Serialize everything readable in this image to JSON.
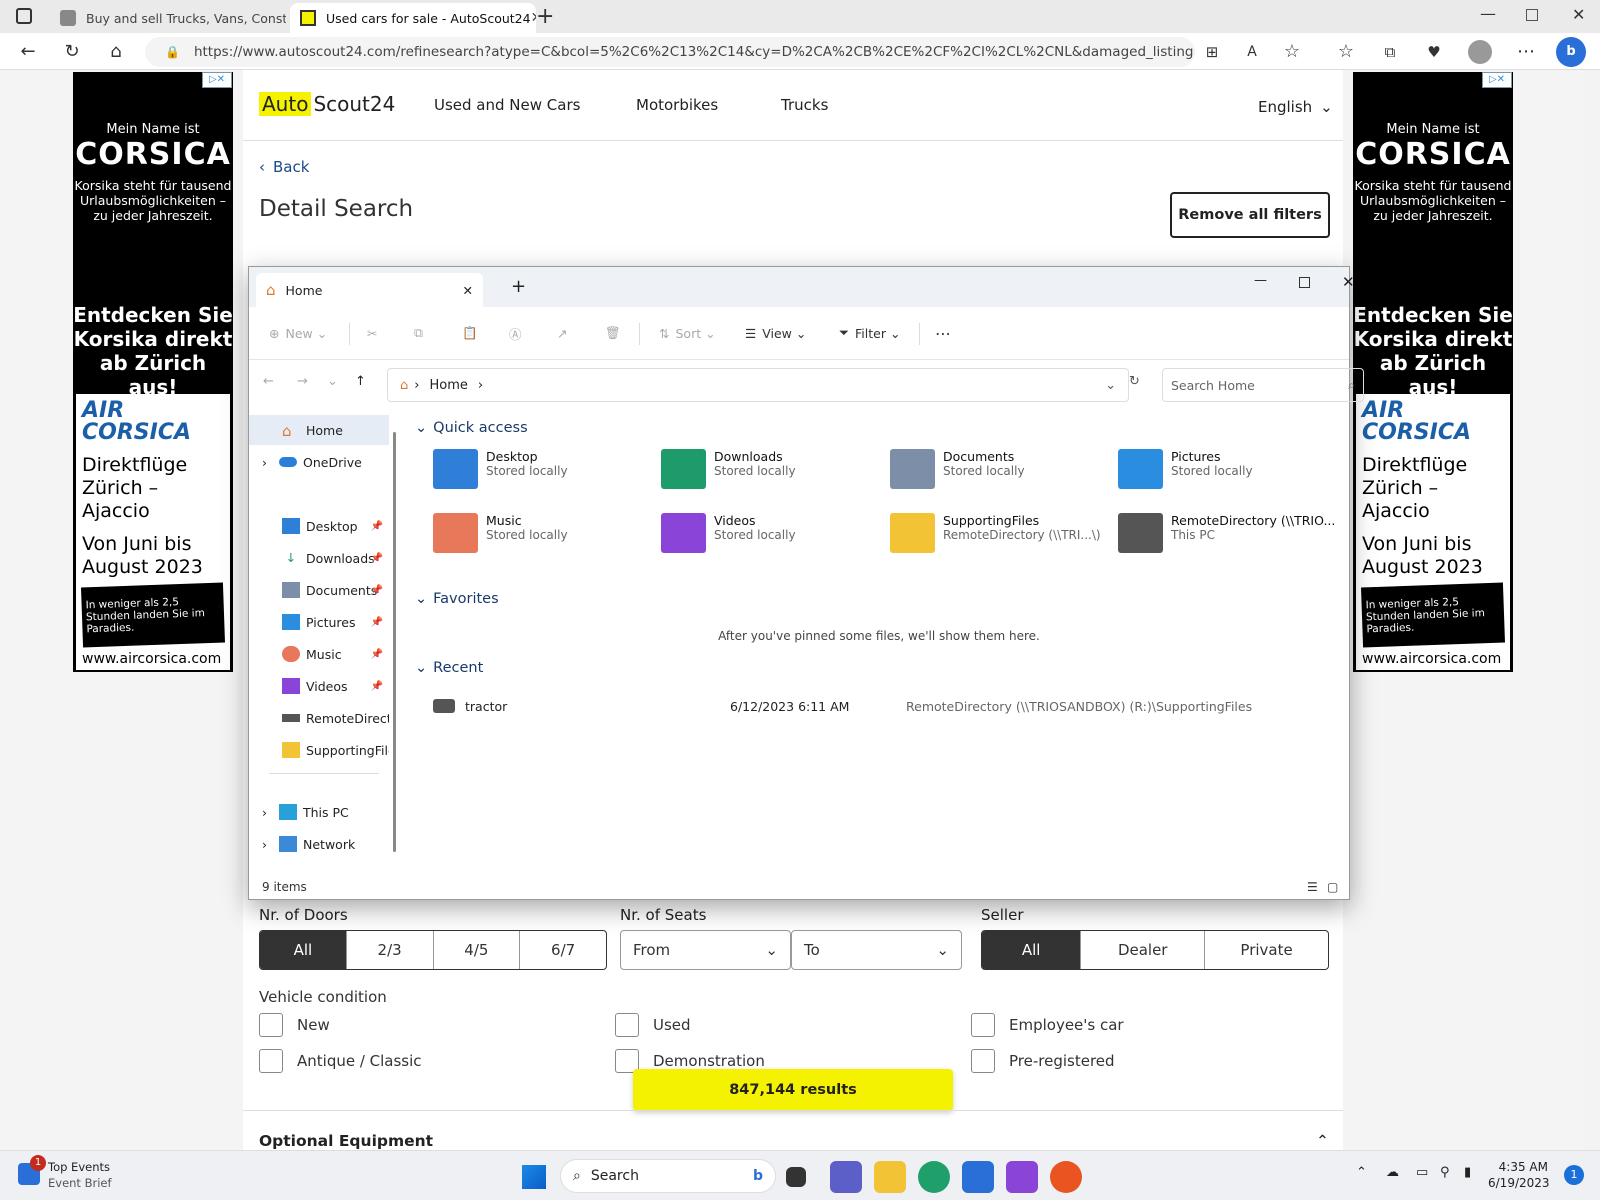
{
  "browser": {
    "tabs": [
      {
        "title": "Buy and sell Trucks, Vans, Constr..."
      },
      {
        "title": "Used cars for sale - AutoScout24"
      }
    ],
    "url": "https://www.autoscout24.com/refinesearch?atype=C&bcol=5%2C6%2C13%2C14&cy=D%2CA%2CB%2CE%2CF%2CI%2CL%2CNL&damaged_listing=exclude&d..."
  },
  "site": {
    "logo_auto": "Auto",
    "logo_scout": "Scout24",
    "nav": [
      "Used and New Cars",
      "Motorbikes",
      "Trucks"
    ],
    "language": "English",
    "back": "Back",
    "title": "Detail Search",
    "remove_filters": "Remove all filters",
    "doors_label": "Nr. of Doors",
    "doors": [
      "All",
      "2/3",
      "4/5",
      "6/7"
    ],
    "seats_label": "Nr. of Seats",
    "seats_from": "From",
    "seats_to": "To",
    "seller_label": "Seller",
    "seller": [
      "All",
      "Dealer",
      "Private"
    ],
    "condition_label": "Vehicle condition",
    "conditions": [
      "New",
      "Used",
      "Employee's car",
      "Antique / Classic",
      "Demonstration",
      "Pre-registered"
    ],
    "results": "847,144 results",
    "optional_equipment": "Optional Equipment"
  },
  "ad": {
    "line1": "Mein Name ist",
    "line2": "CORSICA",
    "line3": "Korsika steht für tausend Urlaubsmöglichkeiten – zu jeder Jahreszeit.",
    "line4": "Entdecken Sie Korsika direkt ab Zürich aus!",
    "brand": "AIR CORSICA",
    "flights": "Direktflüge Zürich – Ajaccio",
    "period": "Von Juni bis August 2023",
    "band": "In weniger als 2,5 Stunden landen Sie im Paradies.",
    "site": "www.aircorsica.com"
  },
  "explorer": {
    "tab_title": "Home",
    "toolbar": {
      "new": "New",
      "sort": "Sort",
      "view": "View",
      "filter": "Filter"
    },
    "path": "Home",
    "search_placeholder": "Search Home",
    "nav": {
      "home": "Home",
      "onedrive": "OneDrive",
      "pinned": [
        "Desktop",
        "Downloads",
        "Documents",
        "Pictures",
        "Music",
        "Videos",
        "RemoteDirector",
        "SupportingFiles"
      ],
      "thispc": "This PC",
      "network": "Network"
    },
    "quick_access_title": "Quick access",
    "quick_access": [
      {
        "name": "Desktop",
        "sub": "Stored locally",
        "color": "#2f7fd8"
      },
      {
        "name": "Downloads",
        "sub": "Stored locally",
        "color": "#1e9b6a"
      },
      {
        "name": "Documents",
        "sub": "Stored locally",
        "color": "#7d8fa8"
      },
      {
        "name": "Pictures",
        "sub": "Stored locally",
        "color": "#2a8de0"
      },
      {
        "name": "Music",
        "sub": "Stored locally",
        "color": "#e8785a"
      },
      {
        "name": "Videos",
        "sub": "Stored locally",
        "color": "#8a44d8"
      },
      {
        "name": "SupportingFiles",
        "sub": "RemoteDirectory (\\\\TRI...\\)",
        "color": "#f2c335"
      },
      {
        "name": "RemoteDirectory (\\\\TRIO...",
        "sub": "This PC",
        "color": "#555555"
      }
    ],
    "favorites_title": "Favorites",
    "favorites_empty": "After you've pinned some files, we'll show them here.",
    "recent_title": "Recent",
    "recent": [
      {
        "name": "tractor",
        "date": "6/12/2023 6:11 AM",
        "location": "RemoteDirectory (\\\\TRIOSANDBOX) (R:)\\SupportingFiles"
      }
    ],
    "status": "9 items"
  },
  "taskbar": {
    "news_title": "Top Events",
    "news_sub": "Event Brief",
    "news_badge": "1",
    "search": "Search",
    "time": "4:35 AM",
    "date": "6/19/2023",
    "notif": "1"
  }
}
